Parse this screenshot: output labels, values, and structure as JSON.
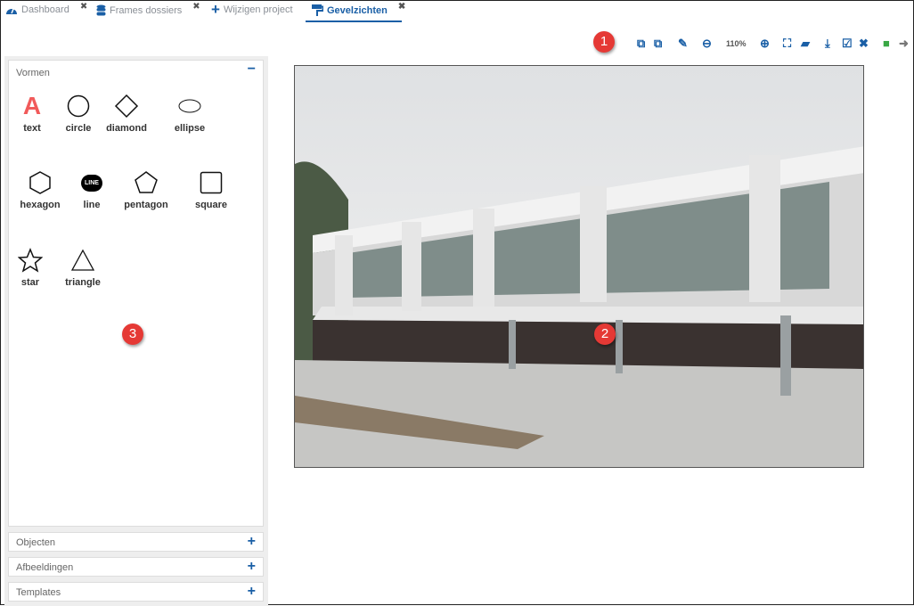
{
  "tabs": [
    {
      "label": "Dashboard",
      "icon": "dashboard-icon",
      "closable": true
    },
    {
      "label": "Frames dossiers",
      "icon": "database-icon",
      "closable": true
    },
    {
      "label": "Wijzigen project",
      "icon": "plus-icon",
      "closable": false
    },
    {
      "label": "Gevelzichten",
      "icon": "paint-roller-icon",
      "closable": true,
      "active": true
    }
  ],
  "close_glyph": "✖",
  "toolbar": {
    "zoom_level": "110%",
    "icons": [
      "crop-icon",
      "crop-alt-icon",
      "pencil-icon",
      "zoom-out-icon",
      "zoom-in-icon",
      "fit-icon",
      "fit-alt-icon",
      "download-icon",
      "check-square-icon",
      "tools-icon",
      "save-icon",
      "exit-icon"
    ]
  },
  "badges": [
    "1",
    "2",
    "3"
  ],
  "panel": {
    "title": "Vormen",
    "shapes": [
      {
        "label": "text",
        "glyph": "A"
      },
      {
        "label": "circle"
      },
      {
        "label": "diamond"
      },
      {
        "label": "ellipse"
      },
      {
        "label": "hexagon"
      },
      {
        "label": "line",
        "glyph": "LINE"
      },
      {
        "label": "pentagon"
      },
      {
        "label": "square"
      },
      {
        "label": "star"
      },
      {
        "label": "triangle"
      }
    ]
  },
  "accordions": [
    {
      "label": "Objecten"
    },
    {
      "label": "Afbeeldingen"
    },
    {
      "label": "Templates"
    }
  ],
  "colors": {
    "accent": "#1a5fa6",
    "badge": "#e53935",
    "text_shape": "#f15a5a",
    "save": "#3aa845"
  }
}
